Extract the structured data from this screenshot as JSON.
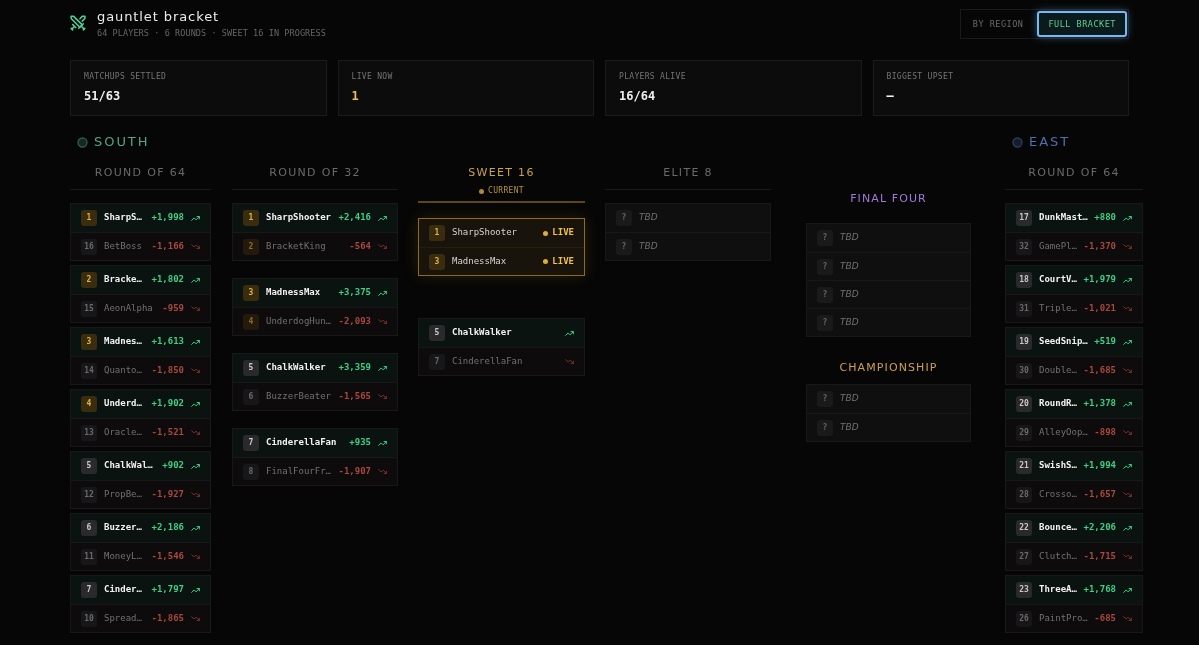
{
  "header": {
    "title": "gauntlet bracket",
    "subtitle": "64 PLAYERS · 6 ROUNDS · SWEET 16 IN PROGRESS"
  },
  "view_toggle": [
    {
      "label": "BY REGION",
      "selected": false
    },
    {
      "label": "FULL BRACKET",
      "selected": true
    }
  ],
  "stats": [
    {
      "label": "MATCHUPS SETTLED",
      "value": "51/63",
      "kind": "plain"
    },
    {
      "label": "LIVE NOW",
      "value": "1",
      "kind": "live"
    },
    {
      "label": "PLAYERS ALIVE",
      "value": "16/64",
      "kind": "plain"
    },
    {
      "label": "BIGGEST UPSET",
      "value": "—",
      "kind": "plain"
    }
  ],
  "bracket": {
    "columns": [
      {
        "kind": "round",
        "region": {
          "name": "SOUTH",
          "color": "#4fa590"
        },
        "title": "ROUND OF 64",
        "current": false,
        "matchups": [
          {
            "live": false,
            "entrants": [
              {
                "kind": "player",
                "seed": "1",
                "name": "SharpS…",
                "score": "+1,998",
                "eliminated": false,
                "top_seed": true
              },
              {
                "kind": "player",
                "seed": "16",
                "name": "BetBoss",
                "score": "-1,166",
                "eliminated": true,
                "top_seed": false
              }
            ]
          },
          {
            "live": false,
            "entrants": [
              {
                "kind": "player",
                "seed": "2",
                "name": "Bracke…",
                "score": "+1,802",
                "eliminated": false,
                "top_seed": true
              },
              {
                "kind": "player",
                "seed": "15",
                "name": "AeonAlpha",
                "score": "-959",
                "eliminated": true,
                "top_seed": false
              }
            ]
          },
          {
            "live": false,
            "entrants": [
              {
                "kind": "player",
                "seed": "3",
                "name": "Madnes…",
                "score": "+1,613",
                "eliminated": false,
                "top_seed": true
              },
              {
                "kind": "player",
                "seed": "14",
                "name": "Quanto…",
                "score": "-1,850",
                "eliminated": true,
                "top_seed": false
              }
            ]
          },
          {
            "live": false,
            "entrants": [
              {
                "kind": "player",
                "seed": "4",
                "name": "Underd…",
                "score": "+1,902",
                "eliminated": false,
                "top_seed": true
              },
              {
                "kind": "player",
                "seed": "13",
                "name": "Oracle…",
                "score": "-1,521",
                "eliminated": true,
                "top_seed": false
              }
            ]
          },
          {
            "live": false,
            "entrants": [
              {
                "kind": "player",
                "seed": "5",
                "name": "ChalkWal…",
                "score": "+902",
                "eliminated": false,
                "top_seed": false
              },
              {
                "kind": "player",
                "seed": "12",
                "name": "PropBe…",
                "score": "-1,927",
                "eliminated": true,
                "top_seed": false
              }
            ]
          },
          {
            "live": false,
            "entrants": [
              {
                "kind": "player",
                "seed": "6",
                "name": "Buzzer…",
                "score": "+2,186",
                "eliminated": false,
                "top_seed": false
              },
              {
                "kind": "player",
                "seed": "11",
                "name": "MoneyL…",
                "score": "-1,546",
                "eliminated": true,
                "top_seed": false
              }
            ]
          },
          {
            "live": false,
            "entrants": [
              {
                "kind": "player",
                "seed": "7",
                "name": "Cinder…",
                "score": "+1,797",
                "eliminated": false,
                "top_seed": false
              },
              {
                "kind": "player",
                "seed": "10",
                "name": "Spread…",
                "score": "-1,865",
                "eliminated": true,
                "top_seed": false
              }
            ]
          }
        ]
      },
      {
        "kind": "round",
        "title": "ROUND OF 32",
        "current": false,
        "matchups": [
          {
            "live": false,
            "entrants": [
              {
                "kind": "player",
                "seed": "1",
                "name": "SharpShooter",
                "score": "+2,416",
                "eliminated": false,
                "top_seed": true
              },
              {
                "kind": "player",
                "seed": "2",
                "name": "BracketKing",
                "score": "-564",
                "eliminated": true,
                "top_seed": true
              }
            ]
          },
          {
            "live": false,
            "entrants": [
              {
                "kind": "player",
                "seed": "3",
                "name": "MadnessMax",
                "score": "+3,375",
                "eliminated": false,
                "top_seed": true
              },
              {
                "kind": "player",
                "seed": "4",
                "name": "UnderdogHun…",
                "score": "-2,093",
                "eliminated": true,
                "top_seed": true
              }
            ]
          },
          {
            "live": false,
            "entrants": [
              {
                "kind": "player",
                "seed": "5",
                "name": "ChalkWalker",
                "score": "+3,359",
                "eliminated": false,
                "top_seed": false
              },
              {
                "kind": "player",
                "seed": "6",
                "name": "BuzzerBeater",
                "score": "-1,565",
                "eliminated": true,
                "top_seed": false
              }
            ]
          },
          {
            "live": false,
            "entrants": [
              {
                "kind": "player",
                "seed": "7",
                "name": "CinderellaFan",
                "score": "+935",
                "eliminated": false,
                "top_seed": false
              },
              {
                "kind": "player",
                "seed": "8",
                "name": "FinalFourFr…",
                "score": "-1,907",
                "eliminated": true,
                "top_seed": false
              }
            ]
          }
        ]
      },
      {
        "kind": "round",
        "title": "SWEET 16",
        "current": true,
        "badge": "CURRENT",
        "matchups": [
          {
            "live": true,
            "entrants": [
              {
                "kind": "player",
                "seed": "1",
                "name": "SharpShooter",
                "status": "LIVE",
                "eliminated": false,
                "top_seed": true
              },
              {
                "kind": "player",
                "seed": "3",
                "name": "MadnessMax",
                "status": "LIVE",
                "eliminated": false,
                "top_seed": true
              }
            ]
          },
          {
            "live": false,
            "entrants": [
              {
                "kind": "player",
                "seed": "5",
                "name": "ChalkWalker",
                "eliminated": false,
                "top_seed": false
              },
              {
                "kind": "player",
                "seed": "7",
                "name": "CinderellaFan",
                "eliminated": true,
                "top_seed": false
              }
            ]
          }
        ]
      },
      {
        "kind": "round",
        "title": "ELITE 8",
        "current": false,
        "matchups": [
          {
            "live": false,
            "entrants": [
              {
                "kind": "tbd",
                "seed": "?",
                "name": "TBD"
              },
              {
                "kind": "tbd",
                "seed": "?",
                "name": "TBD"
              }
            ]
          }
        ]
      },
      {
        "kind": "finals",
        "sections": [
          {
            "title": "FINAL FOUR",
            "color": "#a17ada",
            "matchups": [
              {
                "live": false,
                "entrants": [
                  {
                    "kind": "tbd",
                    "seed": "?",
                    "name": "TBD"
                  },
                  {
                    "kind": "tbd",
                    "seed": "?",
                    "name": "TBD"
                  },
                  {
                    "kind": "tbd",
                    "seed": "?",
                    "name": "TBD"
                  },
                  {
                    "kind": "tbd",
                    "seed": "?",
                    "name": "TBD"
                  }
                ]
              }
            ]
          },
          {
            "title": "CHAMPIONSHIP",
            "color": "#cfa04a",
            "matchups": [
              {
                "live": false,
                "entrants": [
                  {
                    "kind": "tbd",
                    "seed": "?",
                    "name": "TBD"
                  },
                  {
                    "kind": "tbd",
                    "seed": "?",
                    "name": "TBD"
                  }
                ]
              }
            ]
          }
        ]
      },
      {
        "kind": "round",
        "region": {
          "name": "EAST",
          "color": "#4d6fae"
        },
        "title": "ROUND OF 64",
        "current": false,
        "matchups": [
          {
            "live": false,
            "entrants": [
              {
                "kind": "player",
                "seed": "17",
                "name": "DunkMast…",
                "score": "+880",
                "eliminated": false,
                "top_seed": false
              },
              {
                "kind": "player",
                "seed": "32",
                "name": "GamePl…",
                "score": "-1,370",
                "eliminated": true,
                "top_seed": false
              }
            ]
          },
          {
            "live": false,
            "entrants": [
              {
                "kind": "player",
                "seed": "18",
                "name": "CourtV…",
                "score": "+1,979",
                "eliminated": false,
                "top_seed": false
              },
              {
                "kind": "player",
                "seed": "31",
                "name": "Triple…",
                "score": "-1,021",
                "eliminated": true,
                "top_seed": false
              }
            ]
          },
          {
            "live": false,
            "entrants": [
              {
                "kind": "player",
                "seed": "19",
                "name": "SeedSnip…",
                "score": "+519",
                "eliminated": false,
                "top_seed": false
              },
              {
                "kind": "player",
                "seed": "30",
                "name": "Double…",
                "score": "-1,685",
                "eliminated": true,
                "top_seed": false
              }
            ]
          },
          {
            "live": false,
            "entrants": [
              {
                "kind": "player",
                "seed": "20",
                "name": "RoundR…",
                "score": "+1,378",
                "eliminated": false,
                "top_seed": false
              },
              {
                "kind": "player",
                "seed": "29",
                "name": "AlleyOop…",
                "score": "-898",
                "eliminated": true,
                "top_seed": false
              }
            ]
          },
          {
            "live": false,
            "entrants": [
              {
                "kind": "player",
                "seed": "21",
                "name": "SwishS…",
                "score": "+1,994",
                "eliminated": false,
                "top_seed": false
              },
              {
                "kind": "player",
                "seed": "28",
                "name": "Crosso…",
                "score": "-1,657",
                "eliminated": true,
                "top_seed": false
              }
            ]
          },
          {
            "live": false,
            "entrants": [
              {
                "kind": "player",
                "seed": "22",
                "name": "Bounce…",
                "score": "+2,206",
                "eliminated": false,
                "top_seed": false
              },
              {
                "kind": "player",
                "seed": "27",
                "name": "Clutch…",
                "score": "-1,715",
                "eliminated": true,
                "top_seed": false
              }
            ]
          },
          {
            "live": false,
            "entrants": [
              {
                "kind": "player",
                "seed": "23",
                "name": "ThreeA…",
                "score": "+1,768",
                "eliminated": false,
                "top_seed": false
              },
              {
                "kind": "player",
                "seed": "26",
                "name": "PaintPro…",
                "score": "-685",
                "eliminated": true,
                "top_seed": false
              }
            ]
          }
        ]
      }
    ]
  }
}
